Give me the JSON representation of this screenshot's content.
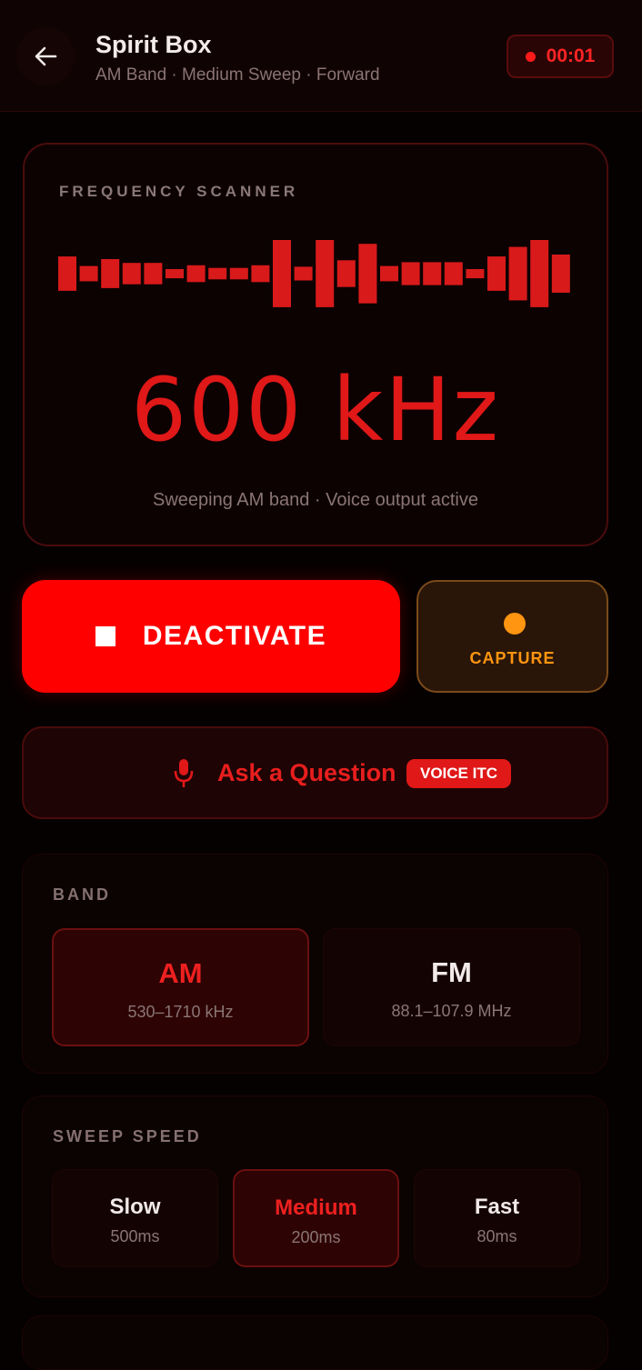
{
  "header": {
    "title": "Spirit Box",
    "subtitle": "AM Band · Medium Sweep · Forward",
    "timer": "00:01",
    "back_icon": "arrow-left-icon"
  },
  "scanner": {
    "label": "FREQUENCY SCANNER",
    "frequency": "600 kHz",
    "status": "Sweeping AM band · Voice output active",
    "bar_levels": [
      0.45,
      0.2,
      0.38,
      0.28,
      0.28,
      0.12,
      0.22,
      0.15,
      0.15,
      0.22,
      0.88,
      0.18,
      0.88,
      0.35,
      0.78,
      0.2,
      0.3,
      0.3,
      0.3,
      0.12,
      0.45,
      0.7,
      0.88,
      0.5
    ],
    "bar_color": "#d91a1a"
  },
  "actions": {
    "deactivate_label": "DEACTIVATE",
    "capture_label": "CAPTURE",
    "ask_label": "Ask a Question",
    "ask_badge": "VOICE ITC",
    "mic_icon": "microphone-icon",
    "stop_icon": "stop-icon"
  },
  "band": {
    "label": "BAND",
    "options": [
      {
        "name": "AM",
        "range": "530–1710 kHz",
        "selected": true
      },
      {
        "name": "FM",
        "range": "88.1–107.9 MHz",
        "selected": false
      }
    ]
  },
  "sweep": {
    "label": "SWEEP SPEED",
    "options": [
      {
        "name": "Slow",
        "detail": "500ms",
        "selected": false
      },
      {
        "name": "Medium",
        "detail": "200ms",
        "selected": true
      },
      {
        "name": "Fast",
        "detail": "80ms",
        "selected": false
      }
    ]
  },
  "colors": {
    "accent": "#ff0000",
    "capture": "#ff9510",
    "background": "#060101"
  }
}
